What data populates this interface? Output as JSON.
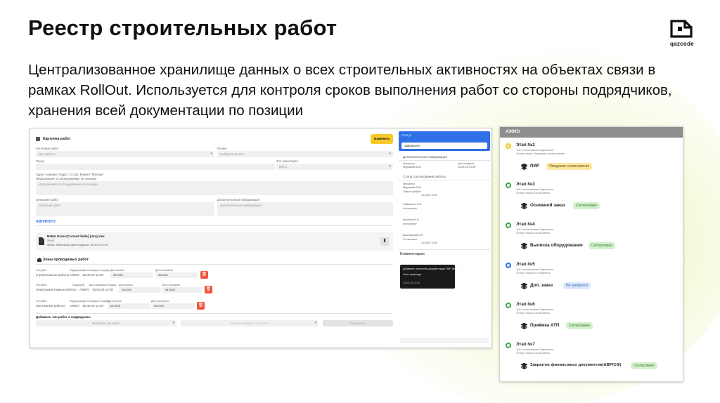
{
  "header": {
    "title": "Реестр строительных работ",
    "subtitle": "Централизованное хранилище данных о всех строительных активностях на объектах связи в рамках RollOut. Используется для контроля сроков выполнения работ со стороны подрядчиков, хранения всей документации по позиции"
  },
  "logo": {
    "text": "qazcode"
  },
  "app": {
    "card_title": "Карточка работ",
    "edit_button": "Изменить",
    "fields": {
      "category_label": "Категория работ",
      "category_placeholder": "Доп работы",
      "region_label": "Регион",
      "region_placeholder": "Выберите регион",
      "city_label": "Город",
      "transport_label": "Тип транспорта",
      "transport_placeholder": "ВОЛС",
      "address_text": "Адрес позиции: Эндуст 21 кор, Маркет \"Магнум\"",
      "equipment_label": "Информация по оборудованию на позиции",
      "equipment_placeholder": "Информация по оборудованию на позиции",
      "desc_label": "Описание работ",
      "desc_placeholder": "Описание работ",
      "extra_label": "Дополнительная информация",
      "extra_placeholder": "Дополнительная информация"
    },
    "docs_section": "АВП/ПП/ТЗ",
    "file": {
      "name": "Better Excel (Current fields) (Jira).xlsx",
      "size": "20 КБ",
      "meta": "Автор: АМунтасин  Дата создания: 15.05.25 12:39"
    },
    "zones_title": "Зоны проводимых работ",
    "zones": [
      {
        "type": "Строительные работы",
        "contractor": "АЖИО",
        "date": "15.05.25 12:00",
        "start": "06.2025",
        "end": "06.2025"
      },
      {
        "type": "Электромонтажные работы",
        "contractor": "АЖИО",
        "date": "15.05.25 12:00",
        "start": "06.2025",
        "end": "06.2025"
      },
      {
        "type": "Монтажные работы",
        "contractor": "АЖИО",
        "date": "15.05.25 12:00",
        "start": "06.2025",
        "end": "06.2025"
      }
    ],
    "zone_labels": {
      "type": "Тип работ",
      "contractor": "Подрядчик",
      "date": "Дата передачи в подряд",
      "start": "Дата начала",
      "end": "Дата окончания"
    },
    "add_work_label": "Добавить тип работ и подрядчика:",
    "add_work_select": "Выберите тип работ",
    "add_contractor_select": "Сначала выберите тип работ",
    "apply_button": "Применить",
    "status": {
      "title": "Статус",
      "value": "Завершено"
    },
    "extra_info": {
      "title": "Дополнительная информация",
      "initiator_label": "Инициатор",
      "initiator": "Мурзаева А.Ж.",
      "date_label": "Дата создания",
      "date": "15.05.25 12:39"
    },
    "approvals": {
      "title": "Статус согласования работы",
      "items": [
        {
          "role": "Инициатор",
          "name": "Мурзаева А.Ж.",
          "sub": "Запрос одобрен",
          "date": "15.05.25 12:39"
        },
        {
          "role": "",
          "name": "Сиванов С.К.О.",
          "sub": "На проверке",
          "date": ""
        },
        {
          "role": "",
          "name": "Бротьев М.И.",
          "sub": "На проверке",
          "date": ""
        },
        {
          "role": "",
          "name": "Быстрицкий К.Е.",
          "sub": "Согласовано",
          "date": "15.05.25 12:39"
        }
      ]
    },
    "comments": {
      "title": "Комментарии",
      "text": "Добавлен: проектная документация ПИР АВП/ТЗ",
      "line2": "Текст перехода",
      "date": "15.05.25 12:00"
    }
  },
  "panel": {
    "title": "АЖИО",
    "meta_type": "Тип согласования:Одиночное",
    "stages": [
      {
        "name": "Этап №2",
        "status": "Статус этапа:Ожидание согласования",
        "doc": "ПИР",
        "badge": "Ожидание согласования",
        "kind": "yellow"
      },
      {
        "name": "Этап №3",
        "status": "Статус этапа:Согласовано",
        "doc": "Основной заказ",
        "badge": "Согласовано",
        "kind": "green"
      },
      {
        "name": "Этап №4",
        "status": "Статус этапа:Согласовано",
        "doc": "Выписка оборудования",
        "badge": "Согласовано",
        "kind": "green"
      },
      {
        "name": "Этап №5",
        "status": "Статус этапа:Не требуется",
        "doc": "Доп. заказ",
        "badge": "Не требуется",
        "kind": "blue"
      },
      {
        "name": "Этап №6",
        "status": "Статус этапа:Согласовано",
        "doc": "Приёмка АТП",
        "badge": "Согласовано",
        "kind": "green"
      },
      {
        "name": "Этап №7",
        "status": "Статус этапа:Согласовано",
        "doc": "Закрытие финансовых документов(АВР/СФ)",
        "badge": "Согласовано",
        "kind": "green"
      }
    ]
  },
  "colors": {
    "accent": "#f6c928",
    "primary": "#2f6fe8",
    "success": "#3fa34d",
    "danger": "#f0543a"
  }
}
